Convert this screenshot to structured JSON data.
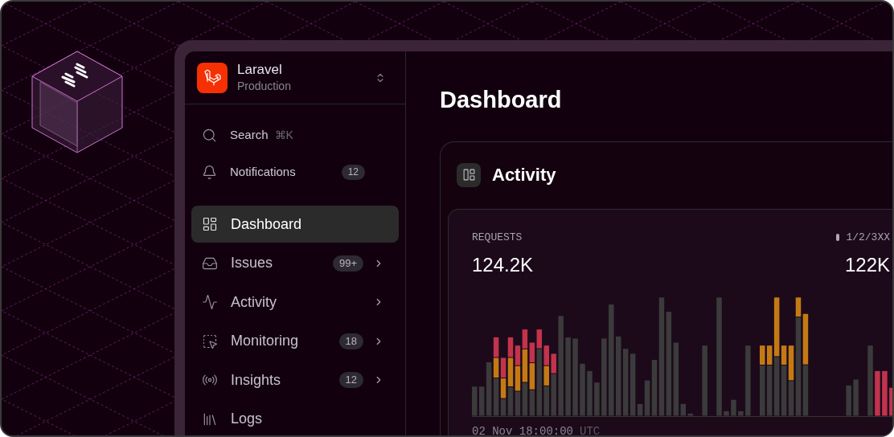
{
  "team": {
    "name": "Laravel",
    "environment": "Production"
  },
  "quick_actions": [
    {
      "kind": "search",
      "label": "Search",
      "shortcut": "⌘K"
    },
    {
      "kind": "notifications",
      "label": "Notifications",
      "badge": "12"
    }
  ],
  "nav_items": [
    {
      "label": "Dashboard",
      "selected": true,
      "expandable": false
    },
    {
      "label": "Issues",
      "badge": "99+",
      "selected": false,
      "expandable": true
    },
    {
      "label": "Activity",
      "selected": false,
      "expandable": true
    },
    {
      "label": "Monitoring",
      "badge": "18",
      "selected": false,
      "expandable": true
    },
    {
      "label": "Insights",
      "badge": "12",
      "selected": false,
      "expandable": true
    },
    {
      "label": "Logs",
      "selected": false,
      "expandable": false
    }
  ],
  "page_title": "Dashboard",
  "card": {
    "title": "Activity",
    "metric": {
      "label": "REQUESTS",
      "value": "124.2K"
    },
    "legend": {
      "label": "1/2/3XX",
      "value": "122K"
    },
    "timestamp": {
      "time": "02 Nov 18:00:00",
      "zone": "UTC"
    }
  }
}
